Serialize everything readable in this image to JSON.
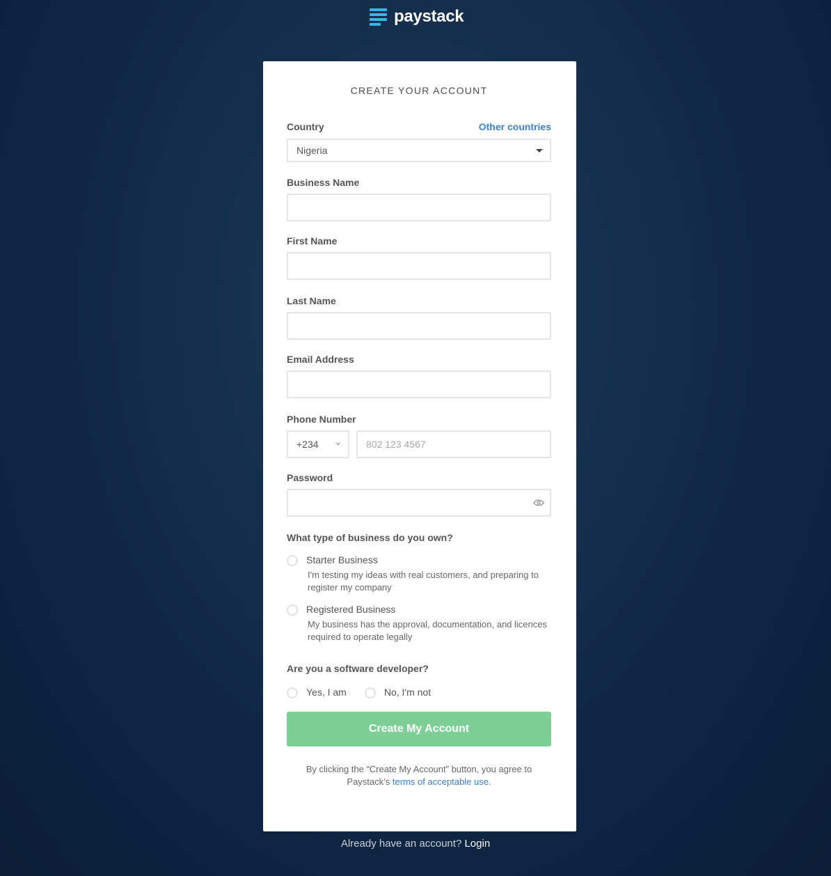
{
  "brand": {
    "name": "paystack",
    "logo_color": "#3bb3e4"
  },
  "form": {
    "title": "CREATE YOUR ACCOUNT",
    "country": {
      "label": "Country",
      "other_link": "Other countries",
      "value": "Nigeria"
    },
    "business_name": {
      "label": "Business Name",
      "value": ""
    },
    "first_name": {
      "label": "First Name",
      "value": ""
    },
    "last_name": {
      "label": "Last Name",
      "value": ""
    },
    "email": {
      "label": "Email Address",
      "value": ""
    },
    "phone": {
      "label": "Phone Number",
      "code": "+234",
      "placeholder": "802 123 4567"
    },
    "password": {
      "label": "Password",
      "value": ""
    },
    "business_type": {
      "question": "What type of business do you own?",
      "options": [
        {
          "label": "Starter Business",
          "description": "I'm testing my ideas with real customers, and preparing to register my company"
        },
        {
          "label": "Registered Business",
          "description": "My business has the approval, documentation, and licences required to operate legally"
        }
      ]
    },
    "developer": {
      "question": "Are you a software developer?",
      "options": [
        {
          "label": "Yes, I am"
        },
        {
          "label": "No, I'm not"
        }
      ]
    },
    "submit_label": "Create My Account",
    "submit_color": "#7ecf95",
    "terms_prefix": "By clicking the “Create My Account” button, you agree to Paystack’s ",
    "terms_link": "terms of acceptable use",
    "terms_suffix": "."
  },
  "footer": {
    "prompt": "Already have an account?",
    "login_label": "Login"
  }
}
